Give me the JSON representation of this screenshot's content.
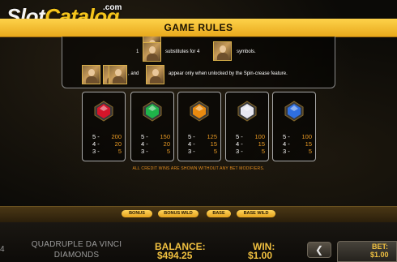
{
  "brand": {
    "slot": "Slot",
    "catalog": "Catalog",
    "suffix": ".com"
  },
  "header": {
    "title": "GAME RULES"
  },
  "rules": {
    "line1_number": "1",
    "line1_middle": "substitutes for 4",
    "line1_end": "symbols.",
    "line2_and": ", and",
    "line2_text": "appear only when unlocked by the Spin-crease feature."
  },
  "paytable": [
    {
      "gem": "ruby-icon",
      "color": "#d4152a",
      "rows": [
        {
          "count": "5 -",
          "value": "200"
        },
        {
          "count": "4 -",
          "value": "20"
        },
        {
          "count": "3 -",
          "value": "5"
        }
      ]
    },
    {
      "gem": "emerald-icon",
      "color": "#1fb34a",
      "rows": [
        {
          "count": "5 -",
          "value": "150"
        },
        {
          "count": "4 -",
          "value": "20"
        },
        {
          "count": "3 -",
          "value": "5"
        }
      ]
    },
    {
      "gem": "topaz-icon",
      "color": "#e88a10",
      "rows": [
        {
          "count": "5 -",
          "value": "125"
        },
        {
          "count": "4 -",
          "value": "15"
        },
        {
          "count": "3 -",
          "value": "5"
        }
      ]
    },
    {
      "gem": "pearl-icon",
      "color": "#e6e6f0",
      "rows": [
        {
          "count": "5 -",
          "value": "100"
        },
        {
          "count": "4 -",
          "value": "15"
        },
        {
          "count": "3 -",
          "value": "5"
        }
      ]
    },
    {
      "gem": "sapphire-icon",
      "color": "#2f6fe0",
      "rows": [
        {
          "count": "5 -",
          "value": "100"
        },
        {
          "count": "4 -",
          "value": "15"
        },
        {
          "count": "3 -",
          "value": "5"
        }
      ]
    }
  ],
  "credit_note": "ALL CREDIT WINS ARE SHOWN WITHOUT ANY BET MODIFIERS.",
  "tabs": [
    {
      "label": "BONUS"
    },
    {
      "label": "BONUS WILD"
    },
    {
      "label": "BASE"
    },
    {
      "label": "BASE WILD"
    }
  ],
  "footer": {
    "left_number": "4",
    "game_title_line1": "QUADRUPLE DA VINCI",
    "game_title_line2": "DIAMONDS",
    "balance_label": "BALANCE:",
    "balance_value": "$494.25",
    "win_label": "WIN:",
    "win_value": "$1.00",
    "arrow": "❮",
    "bet_label": "BET:",
    "bet_value": "$1.00"
  },
  "colors": {
    "accent": "#f0c040",
    "header": "#fdd24a",
    "payout": "#e99a24"
  }
}
